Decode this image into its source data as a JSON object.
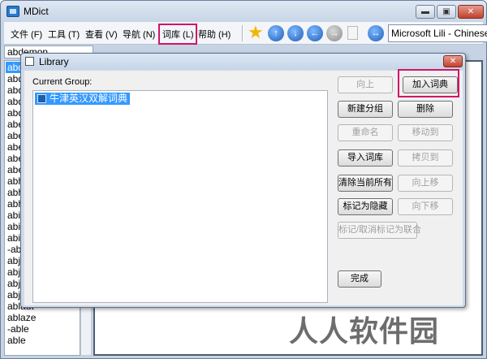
{
  "window": {
    "title": "MDict"
  },
  "window_buttons": {
    "minimize": "▬",
    "maximize": "▣",
    "close": "✕"
  },
  "menu": [
    {
      "label": "文件 (F)"
    },
    {
      "label": "工具 (T)"
    },
    {
      "label": "查看 (V)"
    },
    {
      "label": "导航 (N)"
    },
    {
      "label": "词库 (L)",
      "highlighted": true
    },
    {
      "label": "帮助 (H)"
    }
  ],
  "toolbar": {
    "icons": [
      "star-icon",
      "up-arrow-icon",
      "down-arrow-icon",
      "back-icon",
      "forward-icon",
      "page-icon",
      "dictionary-switch-icon"
    ],
    "dictionary_selector": "Microsoft Lili - Chinese (C"
  },
  "search": {
    "value": "abdemon"
  },
  "word_list": [
    {
      "text": "abd",
      "selected": true
    },
    {
      "text": "abd"
    },
    {
      "text": "abd"
    },
    {
      "text": "abd"
    },
    {
      "text": "abd"
    },
    {
      "text": "abe"
    },
    {
      "text": "abe"
    },
    {
      "text": "abe"
    },
    {
      "text": "abe"
    },
    {
      "text": "abe"
    },
    {
      "text": "abh"
    },
    {
      "text": "abh"
    },
    {
      "text": "abh"
    },
    {
      "text": "abic"
    },
    {
      "text": "abid"
    },
    {
      "text": "abil"
    },
    {
      "text": "-abi"
    },
    {
      "text": "abje"
    },
    {
      "text": "abje"
    },
    {
      "text": "abju"
    },
    {
      "text": "abju"
    },
    {
      "text": "ablaut"
    },
    {
      "text": "ablaze"
    },
    {
      "text": "-able"
    },
    {
      "text": "able"
    }
  ],
  "dialog": {
    "title": "Library",
    "close": "✕",
    "current_group_label": "Current Group:",
    "groups": [
      {
        "name": "牛津英汉双解词典",
        "selected": true
      }
    ],
    "buttons": {
      "move_up_top": "向上",
      "add_dictionary": "加入词典",
      "new_group": "新建分组",
      "delete": "删除",
      "rename": "重命名",
      "move_to": "移动到",
      "import_library": "导入词库",
      "copy_to": "拷贝到",
      "clear_all": "清除当前所有",
      "move_up": "向上移",
      "mark_hidden": "标记为隐藏",
      "move_down": "向下移",
      "toggle_union": "标记/取消标记为联合",
      "done": "完成"
    }
  },
  "watermark": "人人软件园",
  "colors": {
    "highlight_box": "#d21468",
    "selection": "#3399ff"
  }
}
